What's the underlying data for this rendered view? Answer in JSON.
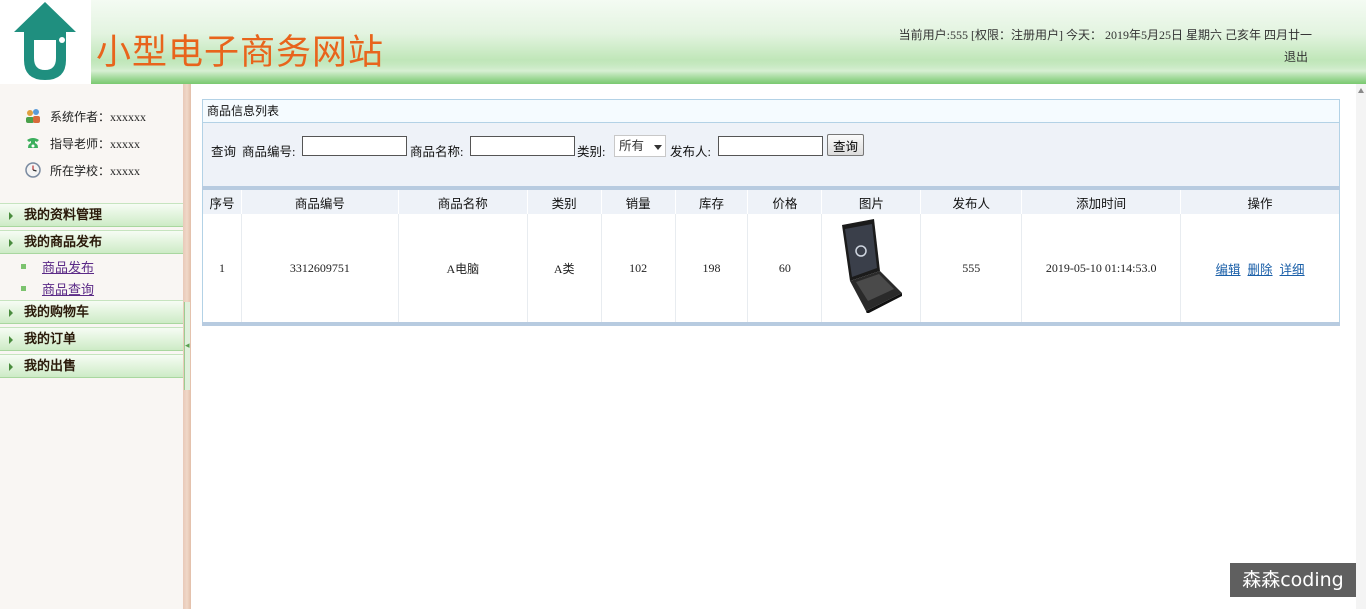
{
  "header": {
    "site_title": "小型电子商务网站",
    "user_info": "当前用户:555 [权限：注册用户] 今天： 2019年5月25日 星期六 己亥年  四月廿一",
    "logout_label": "退出",
    "logo_icon": "house-logo-icon",
    "title_color": "#e8641c"
  },
  "sidebar": {
    "info": [
      {
        "icon": "people-icon",
        "text": "系统作者：xxxxxx"
      },
      {
        "icon": "phone-icon",
        "text": "指导老师：xxxxx"
      },
      {
        "icon": "clock-icon",
        "text": "所在学校：xxxxx"
      }
    ],
    "menu": [
      {
        "label": "我的资料管理"
      },
      {
        "label": "我的商品发布",
        "items": [
          "商品发布",
          "商品查询"
        ]
      },
      {
        "label": "我的购物车"
      },
      {
        "label": "我的订单"
      },
      {
        "label": "我的出售"
      }
    ],
    "splitter_glyph": "◂"
  },
  "panel": {
    "title": "商品信息列表",
    "search": {
      "query_label": "查询",
      "code_label": "商品编号:",
      "code_value": "",
      "name_label": "商品名称:",
      "name_value": "",
      "category_label": "类别:",
      "category_selected": "所有",
      "publisher_label": "发布人:",
      "publisher_value": "",
      "button_label": "查询"
    },
    "table": {
      "headers": [
        "序号",
        "商品编号",
        "商品名称",
        "类别",
        "销量",
        "库存",
        "价格",
        "图片",
        "发布人",
        "添加时间",
        "操作"
      ],
      "rows": [
        {
          "index": "1",
          "code": "3312609751",
          "name": "A电脑",
          "category": "A类",
          "sales": "102",
          "stock": "198",
          "price": "60",
          "image": "laptop-image",
          "publisher": "555",
          "added_time": "2019-05-10 01:14:53.0",
          "actions": [
            "编辑",
            "删除",
            "详细"
          ]
        }
      ]
    }
  },
  "watermark": "森森coding"
}
